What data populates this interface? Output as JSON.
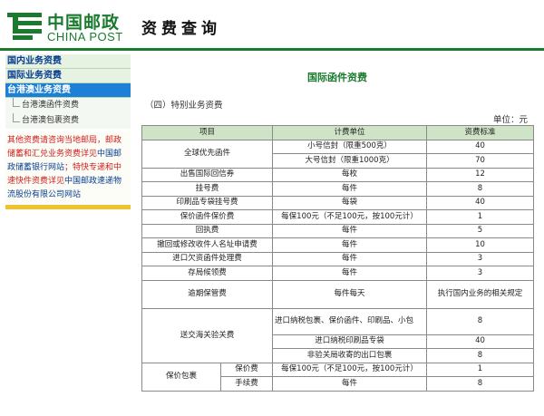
{
  "header": {
    "brand_cn": "中国邮政",
    "brand_en": "CHINA POST",
    "page_heading": "资费查询"
  },
  "sidebar": {
    "nav": [
      {
        "label": "国内业务资费",
        "active": false
      },
      {
        "label": "国际业务资费",
        "active": false
      },
      {
        "label": "台港澳业务资费",
        "active": true
      }
    ],
    "sub_items": [
      "台港澳函件资费",
      "台港澳包裹资费"
    ],
    "notice_red_1": "其他资费请咨询当地邮局，邮政储蓄和汇兑业务资费详见",
    "notice_blue_1": "中国邮政储蓄银行网站",
    "notice_red_2": "；特快专递和中速快件资费详见",
    "notice_blue_2": "中国邮政速递物流股份有限公司网站"
  },
  "main": {
    "title": "国际函件资费",
    "section_label": "（四）特别业务资费",
    "unit_label": "单位：元",
    "columns": [
      "项目",
      "计费单位",
      "资费标准"
    ]
  },
  "rows": {
    "r1_item": "全球优先函件",
    "r1a_unit": "小号信封（限重500克）",
    "r1a_fee": "40",
    "r1b_unit": "大号信封（限重1000克）",
    "r1b_fee": "70",
    "r2_item": "出售国际回信券",
    "r2_unit": "每枚",
    "r2_fee": "12",
    "r3_item": "挂号费",
    "r3_unit": "每件",
    "r3_fee": "8",
    "r4_item": "印刷品专袋挂号费",
    "r4_unit": "每袋",
    "r4_fee": "40",
    "r5_item": "保价函件保价费",
    "r5_unit": "每保100元（不足100元，按100元计）",
    "r5_fee": "1",
    "r6_item": "回执费",
    "r6_unit": "每件",
    "r6_fee": "5",
    "r7_item": "撤回或修改收件人名址申请费",
    "r7_unit": "每件",
    "r7_fee": "10",
    "r8_item": "进口欠资函件处理费",
    "r8_unit": "每件",
    "r8_fee": "3",
    "r9_item": "存局候领费",
    "r9_unit": "每件",
    "r9_fee": "3",
    "r10_item": "逾期保管费",
    "r10_unit": "每件每天",
    "r10_fee": "执行国内业务的相关规定",
    "r11_item": "送交海关验关费",
    "r11a_unit": "进口纳税包裹、保价函件、印刷品、小包",
    "r11a_fee": "8",
    "r11b_unit": "进口纳税印刷品专袋",
    "r11b_fee": "40",
    "r11c_unit": "非验关局收寄的出口包裹",
    "r11c_fee": "8",
    "r12_item": "保价包裹",
    "r12a_sub": "保价费",
    "r12a_unit": "每保100元（不足100元，按100元计）",
    "r12a_fee": "1",
    "r12b_sub": "手续费",
    "r12b_unit": "每件",
    "r12b_fee": "8"
  },
  "colors": {
    "brand_green": "#1a7a2e",
    "nav_blue": "#0a3d91",
    "active_blue": "#1e7fd6",
    "notice_red": "#d21c1c",
    "table_header": "#cfe3c7"
  }
}
